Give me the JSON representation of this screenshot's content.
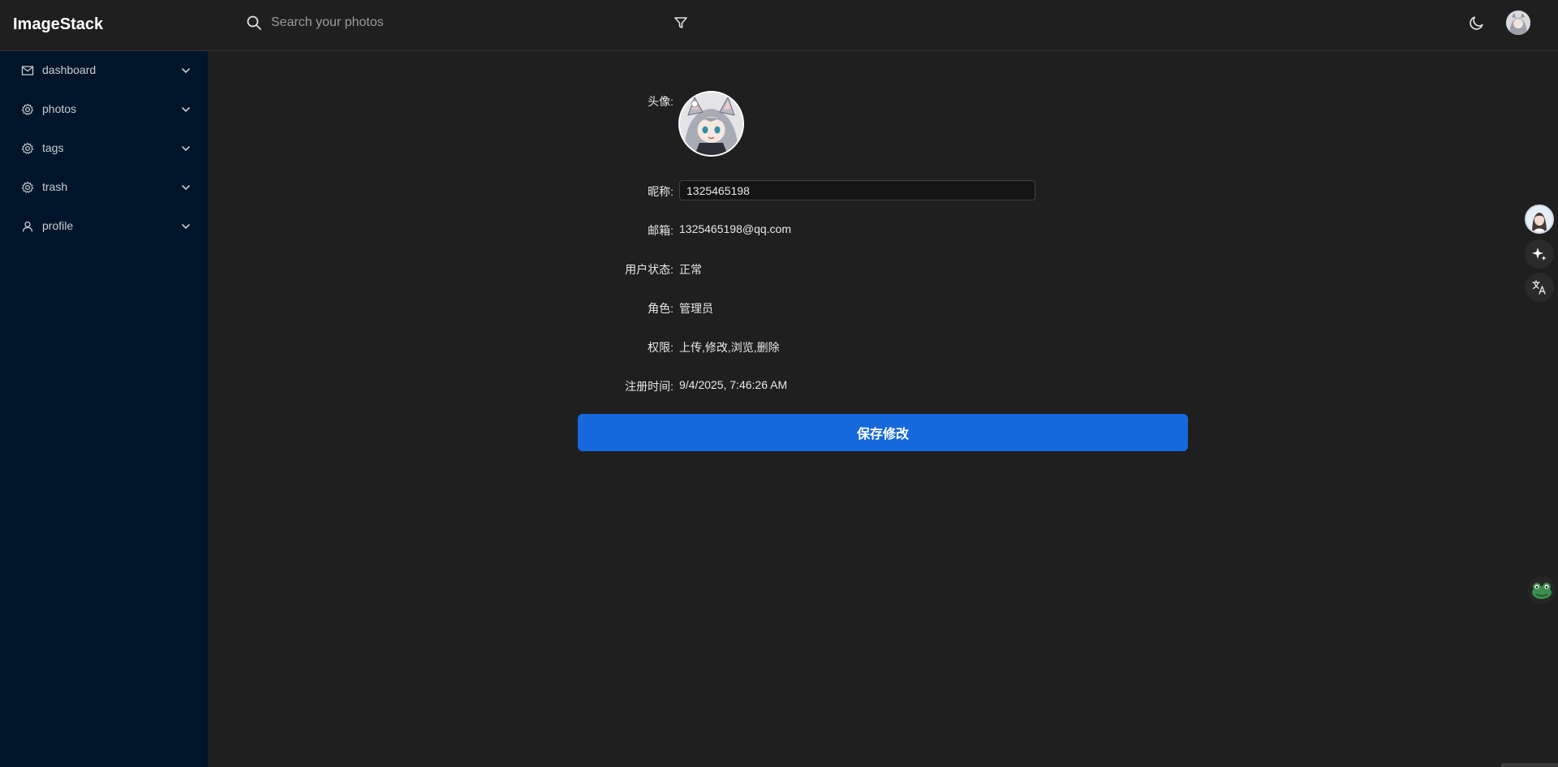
{
  "app": {
    "title": "ImageStack"
  },
  "header": {
    "search_placeholder": "Search your photos"
  },
  "sidebar": {
    "items": [
      {
        "label": "dashboard",
        "icon": "mail-icon"
      },
      {
        "label": "photos",
        "icon": "gear-icon"
      },
      {
        "label": "tags",
        "icon": "gear-icon"
      },
      {
        "label": "trash",
        "icon": "gear-icon"
      },
      {
        "label": "profile",
        "icon": "user-icon"
      }
    ]
  },
  "profile": {
    "avatar_label": "头像:",
    "nickname_label": "昵称:",
    "nickname_value": "1325465198",
    "email_label": "邮箱:",
    "email_value": "1325465198@qq.com",
    "status_label": "用户状态:",
    "status_value": "正常",
    "role_label": "角色:",
    "role_value": "管理员",
    "permissions_label": "权限:",
    "permissions_value": "上传,修改,浏览,删除",
    "registered_label": "注册时间:",
    "registered_value": "9/4/2025, 7:46:26 AM",
    "save_label": "保存修改"
  },
  "colors": {
    "background": "#1f1f1f",
    "sidebar": "#001529",
    "primary": "#1668dc"
  }
}
